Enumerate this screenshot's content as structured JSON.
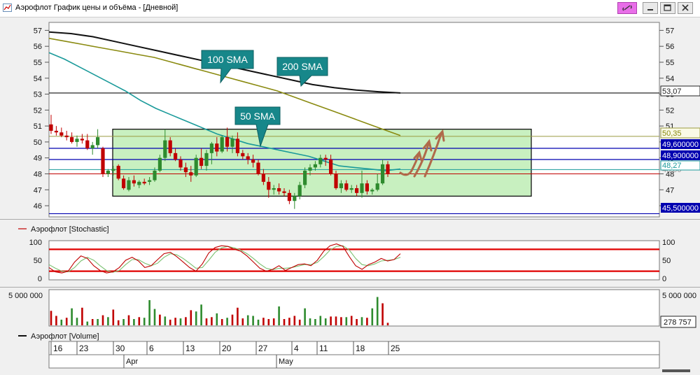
{
  "window": {
    "title": "Аэрофлот График цены и объёма - [Дневной]",
    "link_icon": "link-icon",
    "minimize_icon": "minimize-icon",
    "maximize_icon": "maximize-icon",
    "close_icon": "close-icon"
  },
  "colors": {
    "up": "#2e8b2e",
    "down": "#c00000",
    "sma50": "#1a9a9a",
    "sma100": "#8a8a10",
    "sma200": "#111111",
    "callout": "#17878a",
    "level_blue": "#0000b0",
    "zone_fill": "#c8f0c0",
    "stoch_k": "#c00000",
    "stoch_d": "#7ac070",
    "arrow": "#b06a4a"
  },
  "chart_data": [
    {
      "type": "candlestick",
      "panel": "price",
      "y_ticks": [
        46,
        47,
        48,
        49,
        50,
        51,
        52,
        53,
        54,
        55,
        56,
        57
      ],
      "ylim": [
        45.3,
        57.5
      ],
      "candles": [
        [
          51.1,
          51.7,
          50.5,
          50.7
        ],
        [
          50.7,
          51.0,
          50.4,
          50.6
        ],
        [
          50.6,
          50.9,
          50.3,
          50.4
        ],
        [
          50.4,
          50.7,
          50.1,
          50.3
        ],
        [
          50.3,
          50.6,
          49.9,
          50.0
        ],
        [
          50.0,
          50.4,
          49.7,
          50.2
        ],
        [
          50.2,
          50.5,
          49.9,
          50.1
        ],
        [
          50.1,
          50.5,
          49.5,
          49.6
        ],
        [
          49.6,
          50.0,
          49.2,
          49.8
        ],
        [
          49.8,
          50.8,
          49.6,
          50.3
        ],
        [
          49.6,
          49.7,
          47.8,
          48.0
        ],
        [
          48.0,
          48.3,
          47.8,
          48.2
        ],
        [
          48.2,
          48.5,
          47.9,
          48.3
        ],
        [
          48.5,
          48.6,
          47.6,
          47.7
        ],
        [
          47.7,
          47.9,
          47.0,
          47.1
        ],
        [
          47.0,
          47.8,
          46.9,
          47.6
        ],
        [
          47.6,
          47.9,
          47.2,
          47.4
        ],
        [
          47.3,
          47.6,
          47.1,
          47.5
        ],
        [
          47.5,
          47.7,
          47.3,
          47.4
        ],
        [
          47.5,
          47.8,
          47.3,
          47.6
        ],
        [
          47.6,
          48.4,
          47.5,
          48.2
        ],
        [
          48.2,
          49.2,
          48.1,
          49.0
        ],
        [
          49.0,
          50.8,
          48.8,
          50.1
        ],
        [
          50.1,
          50.3,
          49.1,
          49.3
        ],
        [
          49.3,
          49.6,
          48.8,
          48.9
        ],
        [
          48.9,
          49.1,
          48.2,
          48.4
        ],
        [
          48.4,
          48.7,
          47.8,
          48.1
        ],
        [
          48.1,
          48.5,
          47.5,
          47.9
        ],
        [
          47.9,
          49.2,
          47.8,
          49.0
        ],
        [
          49.0,
          49.6,
          48.3,
          48.5
        ],
        [
          48.5,
          49.5,
          48.2,
          49.3
        ],
        [
          49.3,
          50.0,
          48.6,
          49.9
        ],
        [
          49.9,
          50.3,
          49.1,
          49.4
        ],
        [
          49.4,
          50.4,
          49.3,
          50.3
        ],
        [
          50.3,
          50.9,
          49.4,
          49.7
        ],
        [
          49.7,
          50.4,
          49.3,
          50.2
        ],
        [
          50.2,
          50.6,
          49.1,
          49.3
        ],
        [
          49.3,
          49.5,
          48.9,
          49.1
        ],
        [
          49.1,
          49.3,
          48.6,
          48.9
        ],
        [
          48.9,
          49.2,
          48.4,
          48.7
        ],
        [
          48.7,
          48.9,
          47.9,
          48.0
        ],
        [
          48.0,
          48.3,
          47.3,
          47.5
        ],
        [
          47.5,
          47.8,
          46.5,
          47.0
        ],
        [
          47.0,
          47.3,
          46.7,
          47.1
        ],
        [
          47.1,
          47.4,
          46.7,
          46.9
        ],
        [
          46.9,
          47.1,
          46.6,
          46.8
        ],
        [
          46.8,
          47.0,
          46.1,
          46.3
        ],
        [
          46.3,
          46.8,
          45.8,
          46.6
        ],
        [
          46.6,
          47.5,
          46.4,
          47.3
        ],
        [
          47.3,
          48.4,
          47.1,
          48.2
        ],
        [
          48.2,
          48.6,
          47.9,
          48.4
        ],
        [
          48.4,
          48.8,
          48.2,
          48.6
        ],
        [
          48.6,
          49.2,
          48.4,
          49.0
        ],
        [
          49.0,
          49.2,
          48.5,
          48.9
        ],
        [
          48.9,
          49.2,
          47.9,
          48.0
        ],
        [
          48.0,
          48.2,
          47.0,
          47.1
        ],
        [
          47.1,
          47.6,
          46.8,
          47.4
        ],
        [
          47.4,
          47.6,
          46.9,
          47.0
        ],
        [
          47.0,
          47.3,
          46.8,
          47.1
        ],
        [
          47.1,
          47.3,
          46.6,
          46.8
        ],
        [
          46.8,
          48.2,
          46.5,
          47.4
        ],
        [
          47.4,
          47.6,
          46.7,
          46.9
        ],
        [
          46.9,
          47.1,
          46.7,
          47.0
        ],
        [
          47.0,
          48.0,
          46.9,
          47.4
        ],
        [
          47.4,
          48.9,
          47.3,
          48.6
        ],
        [
          48.6,
          48.8,
          47.8,
          48.0
        ]
      ],
      "sma_50": [
        55.6,
        55.2,
        54.7,
        54.2,
        53.7,
        53.2,
        52.6,
        52.1,
        51.7,
        51.3,
        50.9,
        50.5,
        50.2,
        49.9,
        49.7,
        49.5,
        49.3,
        49.1,
        48.8,
        48.5,
        48.4,
        48.3,
        48.2,
        48.3
      ],
      "sma_100": [
        56.5,
        56.3,
        56.1,
        55.9,
        55.7,
        55.5,
        55.3,
        55.0,
        54.7,
        54.4,
        54.1,
        53.8,
        53.5,
        53.2,
        52.8,
        52.4,
        52.0,
        51.6,
        51.2,
        50.8,
        50.4
      ],
      "sma_200": [
        56.9,
        56.8,
        56.6,
        56.3,
        56.0,
        55.7,
        55.4,
        55.1,
        54.8,
        54.5,
        54.2,
        53.9,
        53.6,
        53.4,
        53.25,
        53.15,
        53.07
      ],
      "levels": [
        53.07,
        49.6,
        48.9,
        45.5
      ],
      "right_labels": {
        "l53": "53,07",
        "l5035": "50,35",
        "l496": "49,600000",
        "l489": "48,900000",
        "l4827": "48,27",
        "l455": "45,500000",
        "hidden": "48,00"
      },
      "zone": {
        "from": 46.6,
        "to": 50.8
      },
      "callouts": {
        "sma100": "100 SMA",
        "sma200": "200 SMA",
        "sma50": "50 SMA"
      }
    },
    {
      "type": "line",
      "panel": "stochastic",
      "legend": "Аэрофлот [Stochastic]",
      "y_ticks": [
        0,
        50,
        100
      ],
      "levels": [
        80,
        20
      ],
      "k": [
        30,
        18,
        15,
        20,
        45,
        62,
        55,
        35,
        22,
        15,
        18,
        30,
        50,
        58,
        48,
        30,
        35,
        52,
        68,
        72,
        60,
        45,
        30,
        20,
        40,
        70,
        85,
        90,
        88,
        80,
        75,
        62,
        45,
        28,
        20,
        25,
        35,
        22,
        30,
        38,
        40,
        35,
        50,
        75,
        90,
        95,
        88,
        60,
        35,
        25,
        38,
        45,
        55,
        48,
        52,
        68
      ],
      "d": [
        38,
        28,
        20,
        18,
        30,
        48,
        58,
        50,
        35,
        22,
        17,
        22,
        38,
        52,
        52,
        42,
        35,
        42,
        58,
        68,
        65,
        55,
        42,
        28,
        30,
        50,
        72,
        84,
        88,
        84,
        78,
        68,
        55,
        40,
        28,
        24,
        28,
        28,
        30,
        34,
        38,
        38,
        44,
        60,
        78,
        88,
        90,
        78,
        55,
        38,
        35,
        40,
        48,
        50,
        52,
        58
      ]
    },
    {
      "type": "bar",
      "panel": "volume",
      "legend": "Аэрофлот [Volume]",
      "tick_label": "5 000 000",
      "last_value": "278 757",
      "values": [
        2300000,
        1500000,
        900000,
        1200000,
        2700000,
        1200000,
        2800000,
        600000,
        1000000,
        1000000,
        1600000,
        1300000,
        2500000,
        800000,
        1000000,
        1600000,
        1000000,
        1300000,
        1200000,
        4000000,
        2600000,
        1700000,
        1400000,
        900000,
        1200000,
        1100000,
        1300000,
        2400000,
        2200000,
        3300000,
        1100000,
        1300000,
        1900000,
        1000000,
        1200000,
        1700000,
        2800000,
        1100000,
        1600000,
        1500000,
        900000,
        1200000,
        1000000,
        1100000,
        3000000,
        1000000,
        1200000,
        1500000,
        900000,
        2700000,
        1100000,
        1000000,
        1500000,
        1100000,
        1400000,
        1400000,
        1300000,
        1300000,
        1500000,
        1000000,
        1300000,
        1200000,
        2700000,
        4500000,
        3500000,
        400000
      ],
      "colors": [
        "down",
        "down",
        "up",
        "down",
        "up",
        "up",
        "down",
        "up",
        "down",
        "up",
        "down",
        "up",
        "down",
        "down",
        "up",
        "down",
        "up",
        "down",
        "up",
        "up",
        "up",
        "down",
        "up",
        "down",
        "down",
        "up",
        "down",
        "down",
        "up",
        "up",
        "down",
        "down",
        "up",
        "down",
        "up",
        "down",
        "down",
        "down",
        "up",
        "up",
        "up",
        "down",
        "down",
        "down",
        "up",
        "down",
        "down",
        "down",
        "down",
        "up",
        "up",
        "up",
        "up",
        "up",
        "down",
        "down",
        "down",
        "up",
        "down",
        "down",
        "up",
        "down",
        "up",
        "up",
        "down",
        "down"
      ]
    }
  ],
  "date_axis": {
    "days": [
      "16",
      "23",
      "30",
      "6",
      "13",
      "20",
      "27",
      "4",
      "11",
      "18",
      "25"
    ],
    "months": [
      "Apr",
      "May"
    ]
  }
}
